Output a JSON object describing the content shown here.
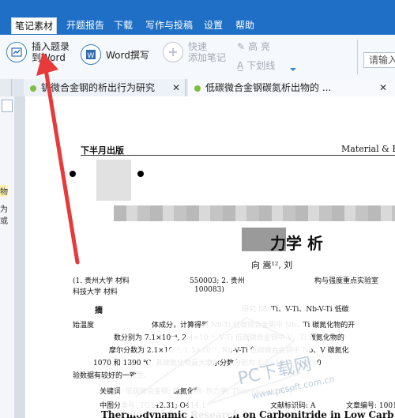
{
  "menu": {
    "items": [
      {
        "label": "笔记素材"
      },
      {
        "label": "开题报告"
      },
      {
        "label": "下载"
      },
      {
        "label": "写作与投稿"
      },
      {
        "label": "设置"
      },
      {
        "label": "帮助"
      }
    ]
  },
  "ribbon": {
    "insert_title_line1": "插入题录",
    "insert_title_line2": "到Word",
    "word_write": "Word撰写",
    "quick_note_line1": "快速",
    "quick_note_line2": "添加笔记",
    "highlight": "高 亮",
    "underline": "下划线",
    "search_placeholder": "请输入"
  },
  "tabs": [
    {
      "label": "钒微合金钢的析出行为研究"
    },
    {
      "label": "低碳微合金钢碳氮析出物的 ..."
    }
  ],
  "side_labels": {
    "a": "物",
    "b": "为或"
  },
  "document": {
    "header_left": "下半月出版",
    "header_right": "Material & Heat",
    "title_fragment": "力学  析",
    "authors": "向 嵩¹², 刘",
    "affil1_left": "(1. 贵州大学  材料",
    "affil1_num": "550003; 2. 贵州",
    "affil1_right": "构与强度重点实验室",
    "affil2": "科技大学  材料",
    "affil2_num": "100083)",
    "abstract_label": "摘",
    "abs1_tail": "研究 Nb-Ti、V-Ti、Nb-V-Ti 低碳",
    "abs2": "始温度",
    "abs2b": "体成分，计算得到 Nb-Ti 低碳微合金钢中 Nb、Ti 碳氮化物的开",
    "abs3": "数分别为 7.1×10⁻⁴, 2.4×10⁻⁴, V-Ti 低碳微合金钢中 V、Ti 碳氮化物的",
    "abs4": "摩尔分数为 2.1×10⁻³, 1.5×10⁻⁴, Nb-V-Ti 低碳微合金钢中 Nb、V 碳氮化",
    "abs5": "1070 和 1390 ℃, 其碳氮化物最大摩尔分数分别为 1.2×10⁻³, 1.4×10",
    "abs6": "验数据有较好的一致性。",
    "keywords": "关键词: 低碳微合金钢; 碳氮化物; 热力学; Thermo-calc 软件",
    "clc": "中图分类号: TG142.31; O414.1",
    "doc_code": "文献标识码: A",
    "article_no": "文章编号: 1001-3",
    "eng_title": "Thermodynamic Research on Carbonitride in Low Carb"
  },
  "watermark": {
    "text1": "PC下载网",
    "text2": "www.pcsoft.com.cn"
  }
}
